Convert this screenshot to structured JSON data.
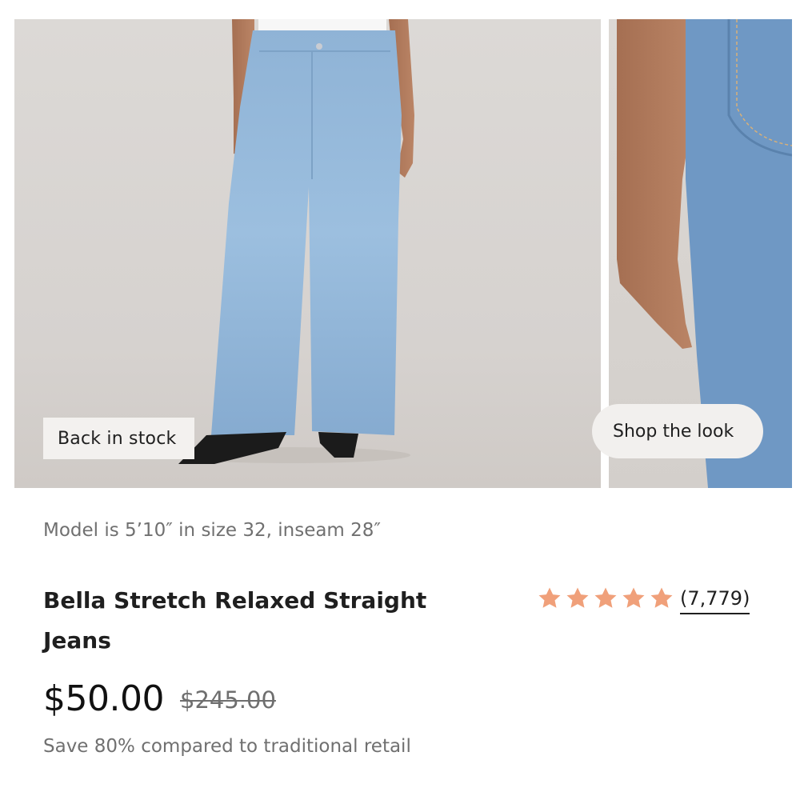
{
  "gallery": {
    "badge_label": "Back in stock",
    "shop_look_label": "Shop the look"
  },
  "product": {
    "model_note": "Model is 5’10″ in size 32, inseam 28″",
    "title": "Bella Stretch Relaxed Straight Jeans",
    "rating": {
      "stars": 5,
      "review_count": "(7,779)",
      "star_color": "#f0a07a"
    },
    "price": "$50.00",
    "original_price": "$245.00",
    "savings_note": "Save 80% compared to traditional retail"
  }
}
